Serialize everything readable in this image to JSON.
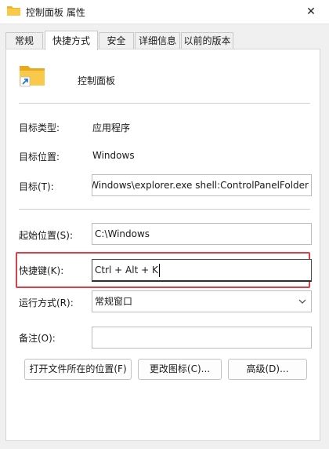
{
  "window": {
    "title": "控制面板 属性",
    "close_glyph": "✕"
  },
  "tabs": [
    {
      "label": "常规",
      "active": false
    },
    {
      "label": "快捷方式",
      "active": true
    },
    {
      "label": "安全",
      "active": false
    },
    {
      "label": "详细信息",
      "active": false
    },
    {
      "label": "以前的版本",
      "active": false
    }
  ],
  "header": {
    "name": "控制面板",
    "icon": "shortcut-folder-icon"
  },
  "info": {
    "target_type_label": "目标类型:",
    "target_type_value": "应用程序",
    "target_location_label": "目标位置:",
    "target_location_value": "Windows"
  },
  "fields": {
    "target_label": "目标(T):",
    "target_value": "C:\\Windows\\explorer.exe shell:ControlPanelFolder",
    "start_in_label": "起始位置(S):",
    "start_in_value": "C:\\Windows",
    "shortcut_key_label": "快捷键(K):",
    "shortcut_key_value": "Ctrl + Alt + K",
    "run_label": "运行方式(R):",
    "run_value": "常规窗口",
    "comment_label": "备注(O):",
    "comment_value": ""
  },
  "buttons": {
    "open_location": "打开文件所在的位置(F)",
    "change_icon": "更改图标(C)...",
    "advanced": "高级(D)..."
  },
  "colors": {
    "highlight_box": "#d9404a",
    "folder_yellow": "#f8c94a",
    "shortcut_arrow": "#1c6fc9"
  }
}
